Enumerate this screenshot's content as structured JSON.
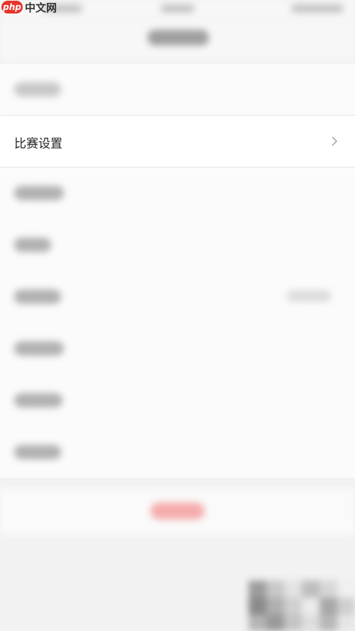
{
  "watermark": {
    "badge": "php",
    "text": "中文网"
  },
  "settings": {
    "highlighted_item": {
      "label": "比赛设置"
    }
  },
  "colors": {
    "accent_red": "#e8342b",
    "action_red": "#f26b6b"
  }
}
